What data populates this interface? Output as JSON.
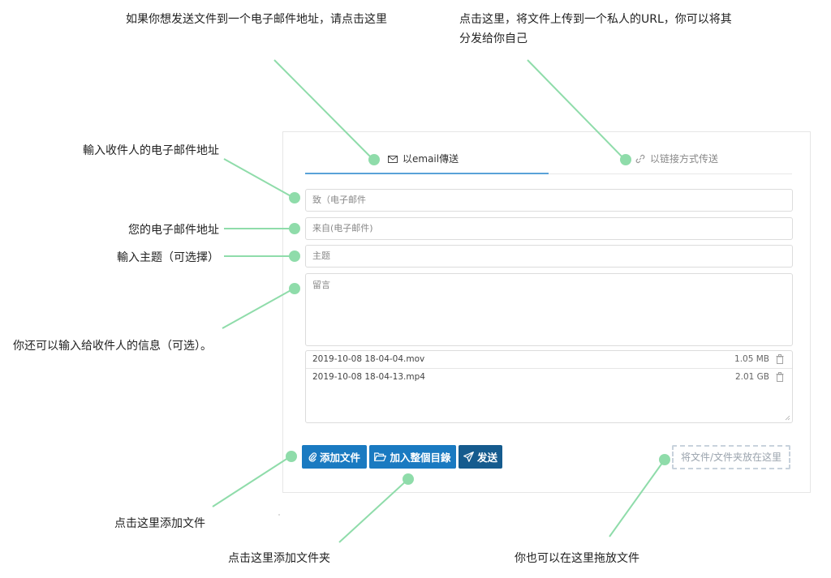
{
  "annotations": {
    "email_tab": "如果你想发送文件到一个电子邮件地址，请点击这里",
    "link_tab": "点击这里，将文件上传到一个私人的URL，你可以将其分发给你自己",
    "to_field": "輸入收件人的电子邮件地址",
    "from_field": "您的电子邮件地址",
    "subject_field": "輸入主题（可选擇）",
    "message_field": "你还可以输入给收件人的信息（可选）。",
    "add_files": "点击这里添加文件",
    "add_folder": "点击这里添加文件夹",
    "drop_zone": "你也可以在这里拖放文件"
  },
  "tabs": {
    "email": "以email傳送",
    "link": "以链接方式传送"
  },
  "form": {
    "to_placeholder": "致（电子邮件",
    "from_placeholder": "来自(电子邮件)",
    "subject_placeholder": "主题",
    "message_placeholder": "留言"
  },
  "files": [
    {
      "name": "2019-10-08 18-04-04.mov",
      "size": "1.05 MB"
    },
    {
      "name": "2019-10-08 18-04-13.mp4",
      "size": "2.01 GB"
    }
  ],
  "buttons": {
    "add_files": "添加文件",
    "add_folder": "加入整個目錄",
    "send": "发送"
  },
  "drop_zone": "将文件/文件夹放在这里",
  "colors": {
    "marker": "#8fdcaa",
    "primary_button": "#1a7ac1",
    "send_button": "#155b8e",
    "tab_active": "#5aa2d8"
  },
  "icons": {
    "email_tab": "envelope-icon",
    "link_tab": "link-icon",
    "add_files": "paperclip-icon",
    "add_folder": "folder-open-icon",
    "send": "paper-plane-icon",
    "file_remove": "trash-icon"
  }
}
